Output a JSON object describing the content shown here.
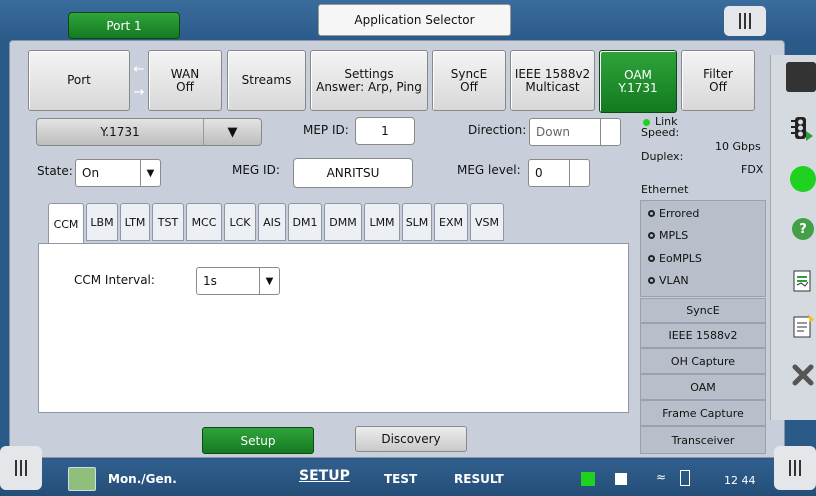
{
  "header": {
    "port_tab": "Port 1",
    "app_selector": "Application Selector"
  },
  "function_buttons": [
    {
      "line1": "Port",
      "line2": "",
      "active": false
    },
    {
      "line1": "WAN",
      "line2": "Off",
      "active": false
    },
    {
      "line1": "Streams",
      "line2": "",
      "active": false
    },
    {
      "line1": "Settings",
      "line2": "Answer: Arp, Ping",
      "active": false
    },
    {
      "line1": "SyncE",
      "line2": "Off",
      "active": false
    },
    {
      "line1": "IEEE 1588v2",
      "line2": "Multicast",
      "active": false
    },
    {
      "line1": "OAM",
      "line2": "Y.1731",
      "active": true
    },
    {
      "line1": "Filter",
      "line2": "Off",
      "active": false
    }
  ],
  "port_arrows": {
    "right": "←",
    "left": "→"
  },
  "oam_config": {
    "mode_value": "Y.1731",
    "mep_id_label": "MEP ID:",
    "mep_id_value": "1",
    "direction_label": "Direction:",
    "direction_value": "Down",
    "state_label": "State:",
    "state_value": "On",
    "meg_id_label": "MEG ID:",
    "meg_id_value": "ANRITSU",
    "meg_level_label": "MEG level:",
    "meg_level_value": "0"
  },
  "tabs": [
    "CCM",
    "LBM",
    "LTM",
    "TST",
    "MCC",
    "LCK",
    "AIS",
    "DM1",
    "DMM",
    "LMM",
    "SLM",
    "EXM",
    "VSM"
  ],
  "active_tab": "CCM",
  "ccm": {
    "interval_label": "CCM Interval:",
    "interval_value": "1s"
  },
  "actions": {
    "setup": "Setup",
    "discovery": "Discovery"
  },
  "status_panel": {
    "link": "Link",
    "speed_label": "Speed:",
    "speed_value": "10 Gbps",
    "duplex_label": "Duplex:",
    "duplex_value": "FDX",
    "ethernet": "Ethernet",
    "items": [
      "Errored",
      "MPLS",
      "EoMPLS",
      "VLAN"
    ],
    "sections": [
      "SyncE",
      "IEEE 1588v2",
      "OH Capture",
      "OAM",
      "Frame Capture",
      "Transceiver"
    ]
  },
  "taskbar": {
    "app_name": "Mon./Gen.",
    "setup": "SETUP",
    "test": "TEST",
    "result": "RESULT",
    "clock": "12 44"
  },
  "colors": {
    "accent_green": "#2fa43a",
    "background_blue": "#2a5a88",
    "panel": "#c9cfda"
  },
  "icons": [
    "traffic-light-icon",
    "status-green-icon",
    "help-icon",
    "report-icon",
    "notes-icon",
    "tools-icon"
  ]
}
